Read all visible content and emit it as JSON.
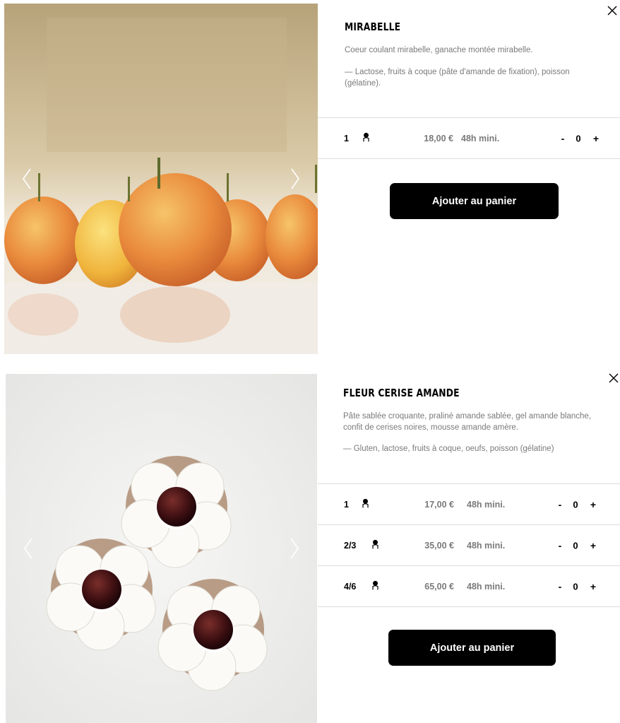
{
  "products": [
    {
      "name": "MIRABELLE",
      "description": "Coeur coulant mirabelle, ganache montée mirabelle.",
      "allergens": "— Lactose, fruits à coque (pâte d'amande de fixation), poisson (gélatine).",
      "options": [
        {
          "size": "1",
          "icon": "person-icon",
          "price": "18,00 €",
          "delay": "48h mini.",
          "minus": "-",
          "qty": "0",
          "plus": "+"
        }
      ],
      "add_to_cart": "Ajouter au panier"
    },
    {
      "name": "FLEUR CERISE AMANDE",
      "description": "Pâte sablée croquante, praliné amande sablée, gel amande blanche, confit de cerises noires, mousse amande amère.",
      "allergens": "— Gluten, lactose, fruits à coque, oeufs, poisson (gélatine)",
      "options": [
        {
          "size": "1",
          "icon": "person-icon",
          "price": "17,00 €",
          "delay": "48h mini.",
          "minus": "-",
          "qty": "0",
          "plus": "+"
        },
        {
          "size": "2/3",
          "icon": "person-icon",
          "price": "35,00 €",
          "delay": "48h mini.",
          "minus": "-",
          "qty": "0",
          "plus": "+"
        },
        {
          "size": "4/6",
          "icon": "person-icon",
          "price": "65,00 €",
          "delay": "48h mini.",
          "minus": "-",
          "qty": "0",
          "plus": "+"
        }
      ],
      "add_to_cart": "Ajouter au panier"
    }
  ],
  "icons": {
    "close": "close-icon",
    "prev": "chevron-left-icon",
    "next": "chevron-right-icon",
    "person": "person-icon"
  }
}
